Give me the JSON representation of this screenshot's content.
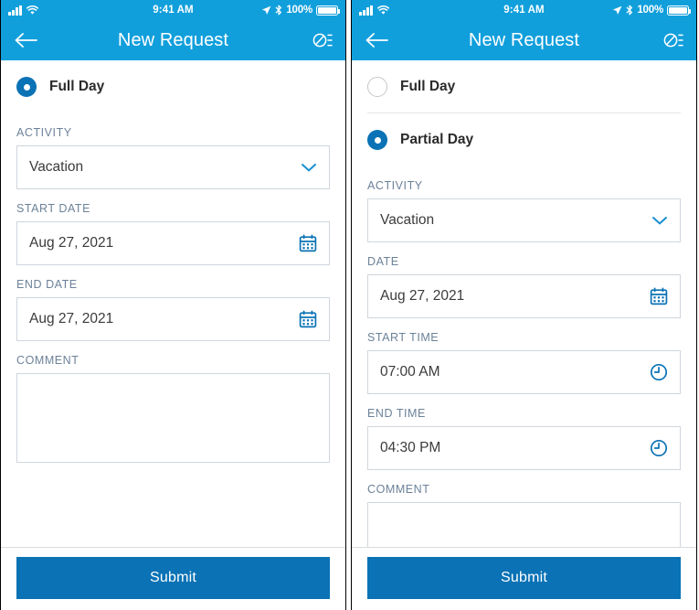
{
  "status_bar": {
    "time": "9:41 AM",
    "battery_percent": "100%",
    "icons": [
      "signal-bars-icon",
      "wifi-icon",
      "location-arrow-icon",
      "bluetooth-icon",
      "battery-icon"
    ]
  },
  "nav": {
    "title": "New Request",
    "back_icon": "back-arrow-icon",
    "action_icon": "no-notes-icon"
  },
  "screens": [
    {
      "id": "full-day-screen",
      "options": [
        {
          "label": "Full Day",
          "selected": true
        }
      ],
      "fields": [
        {
          "key": "activity",
          "label": "ACTIVITY",
          "value": "Vacation",
          "icon": "chevron-down-icon",
          "type": "select"
        },
        {
          "key": "start_date",
          "label": "START DATE",
          "value": "Aug 27, 2021",
          "icon": "calendar-icon",
          "type": "date"
        },
        {
          "key": "end_date",
          "label": "END DATE",
          "value": "Aug 27, 2021",
          "icon": "calendar-icon",
          "type": "date"
        },
        {
          "key": "comment",
          "label": "COMMENT",
          "value": "",
          "icon": "",
          "type": "textarea"
        }
      ],
      "submit_label": "Submit"
    },
    {
      "id": "partial-day-screen",
      "options": [
        {
          "label": "Full Day",
          "selected": false
        },
        {
          "label": "Partial Day",
          "selected": true
        }
      ],
      "fields": [
        {
          "key": "activity",
          "label": "ACTIVITY",
          "value": "Vacation",
          "icon": "chevron-down-icon",
          "type": "select"
        },
        {
          "key": "date",
          "label": "DATE",
          "value": "Aug 27, 2021",
          "icon": "calendar-icon",
          "type": "date"
        },
        {
          "key": "start_time",
          "label": "START TIME",
          "value": "07:00 AM",
          "icon": "clock-icon",
          "type": "time"
        },
        {
          "key": "end_time",
          "label": "END TIME",
          "value": "04:30 PM",
          "icon": "clock-icon",
          "type": "time"
        },
        {
          "key": "comment",
          "label": "COMMENT",
          "value": "",
          "icon": "",
          "type": "label-only"
        }
      ],
      "submit_label": "Submit"
    }
  ],
  "colors": {
    "header_blue": "#119fdc",
    "accent_blue": "#0a72b5",
    "label_gray": "#6c8299",
    "border_gray": "#cfd6dc"
  }
}
